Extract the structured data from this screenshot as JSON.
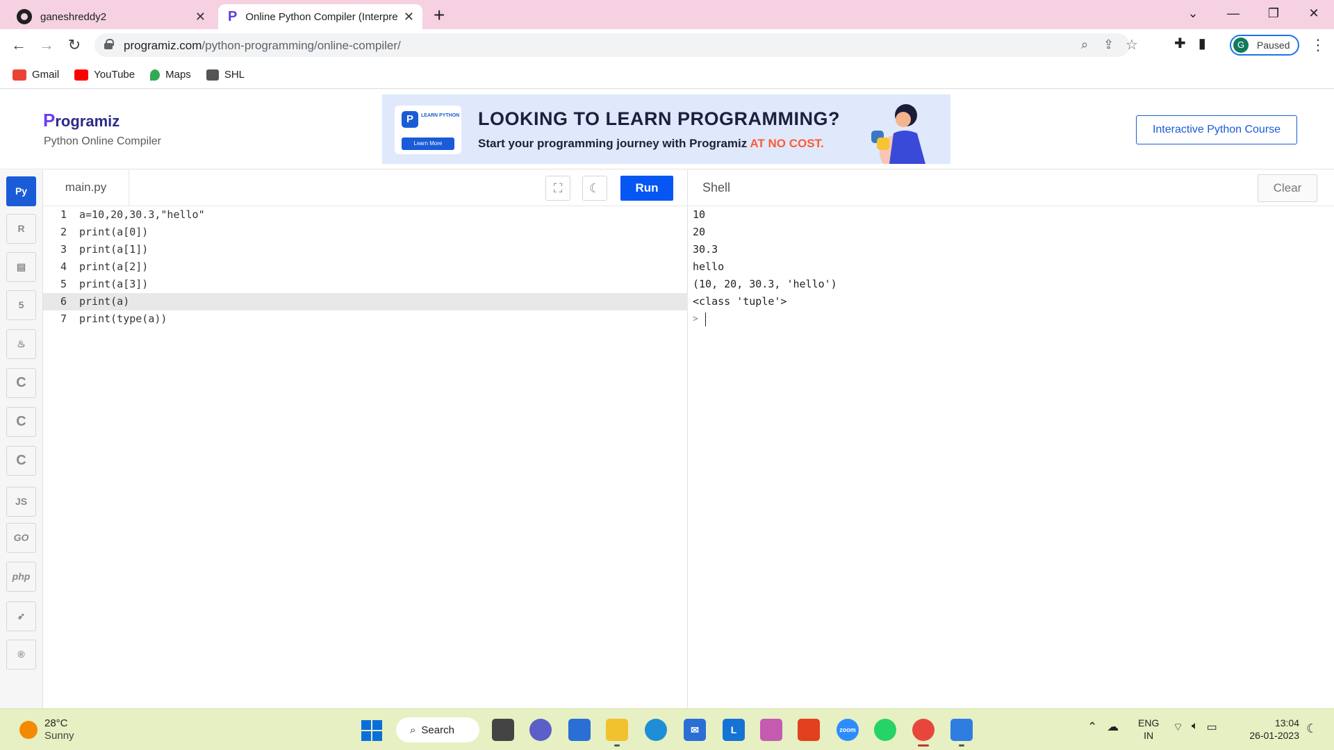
{
  "browser": {
    "tabs": [
      {
        "title": "ganeshreddy2",
        "icon": "github-icon"
      },
      {
        "title": "Online Python Compiler (Interpreter)",
        "icon": "programiz-icon"
      }
    ],
    "new_tab": "+",
    "address": {
      "domain": "programiz.com",
      "path": "/python-programming/online-compiler/"
    },
    "profile": {
      "initial": "G",
      "status": "Paused"
    },
    "bookmarks": [
      {
        "label": "Gmail",
        "icon": "gmail-icon",
        "color": "#ea4335"
      },
      {
        "label": "YouTube",
        "icon": "youtube-icon",
        "color": "#ff0000"
      },
      {
        "label": "Maps",
        "icon": "maps-icon",
        "color": "#34a853"
      },
      {
        "label": "SHL",
        "icon": "shl-icon",
        "color": "#555555"
      }
    ]
  },
  "site": {
    "logo": "rogramiz",
    "logo_p": "P",
    "subtitle": "Python Online Compiler",
    "banner": {
      "title": "LOOKING TO LEARN PROGRAMMING?",
      "subtitle": "Start your programming journey with Programiz ",
      "highlight": "AT NO COST.",
      "card_tag": "LEARN PYTHON",
      "card_button": "Learn More"
    },
    "course_button": "Interactive Python Course"
  },
  "languages": [
    "Python",
    "R",
    "SQL",
    "HTML",
    "Java",
    "C",
    "C++",
    "C#",
    "JS",
    "GO",
    "php",
    "Swift",
    "Rust"
  ],
  "editor": {
    "file_name": "main.py",
    "run_label": "Run",
    "active_line": 6,
    "lines": [
      "a=10,20,30.3,\"hello\"",
      "print(a[0])",
      "print(a[1])",
      "print(a[2])",
      "print(a[3])",
      "print(a)",
      "print(type(a))"
    ]
  },
  "shell": {
    "title": "Shell",
    "clear_label": "Clear",
    "output": [
      "10",
      "20",
      "30.3",
      "hello",
      "(10, 20, 30.3, 'hello')",
      "<class 'tuple'>"
    ],
    "prompt": ">"
  },
  "taskbar": {
    "weather": {
      "temp": "28°C",
      "condition": "Sunny"
    },
    "search_label": "Search",
    "language": {
      "line1": "ENG",
      "line2": "IN"
    },
    "clock": {
      "time": "13:04",
      "date": "26-01-2023"
    },
    "zoom_label": "zoom",
    "notes_label": "L"
  },
  "colors": {
    "accent": "#0556f3",
    "tab_bar": "#f5d1e1",
    "taskbar": "#e6f0c2"
  }
}
